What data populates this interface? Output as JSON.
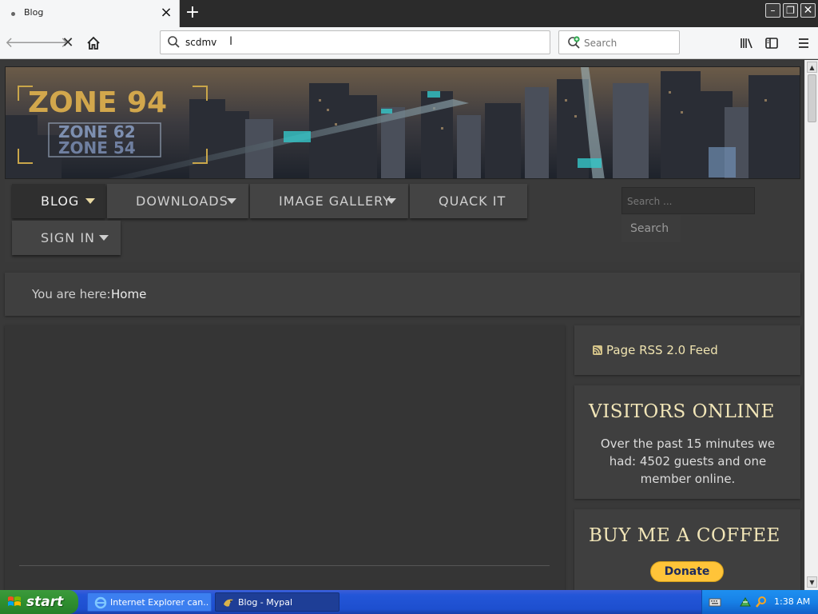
{
  "browser": {
    "tab": {
      "title": "Blog"
    },
    "new_tab": "+",
    "url": "scdmv",
    "search_placeholder": "Search"
  },
  "site": {
    "logo": {
      "main": "ZONE 94",
      "sub1": "ZONE 62",
      "sub2": "ZONE 54"
    },
    "menu": [
      {
        "label": "BLOG",
        "has_dropdown": true,
        "active": true
      },
      {
        "label": "DOWNLOADS",
        "has_dropdown": true,
        "active": false
      },
      {
        "label": "IMAGE GALLERY",
        "has_dropdown": true,
        "active": false
      },
      {
        "label": "QUACK IT",
        "has_dropdown": false,
        "active": false
      },
      {
        "label": "SIGN IN",
        "has_dropdown": true,
        "active": false
      }
    ],
    "search": {
      "placeholder": "Search ...",
      "button": "Search"
    },
    "breadcrumb": {
      "label": "You are here:",
      "current": "Home"
    },
    "sidebar": {
      "rss": {
        "label": "Page RSS 2.0 Feed",
        "icon": "rss-icon"
      },
      "visitors": {
        "title": "VISITORS ONLINE",
        "text": "Over the past 15 minutes we had: 4502 guests and one member online."
      },
      "coffee": {
        "title": "BUY ME A COFFEE",
        "button": "Donate"
      }
    }
  },
  "taskbar": {
    "start": "start",
    "tasks": [
      {
        "label": "Internet Explorer can...",
        "icon": "internet-explorer-icon",
        "active": false
      },
      {
        "label": "Blog - Mypal",
        "icon": "mypal-icon",
        "active": true
      }
    ],
    "clock": "1:38 AM"
  },
  "colors": {
    "accent_heading": "#f2e6b8",
    "page_bg": "#393939",
    "taskbar_blue": "#2356d8",
    "donate_yellow": "#ffc439"
  }
}
